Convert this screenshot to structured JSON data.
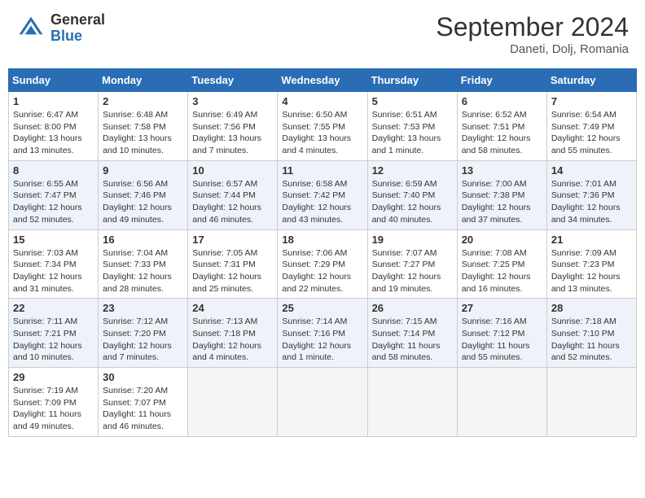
{
  "header": {
    "logo_general": "General",
    "logo_blue": "Blue",
    "title": "September 2024",
    "location": "Daneti, Dolj, Romania"
  },
  "calendar": {
    "days_of_week": [
      "Sunday",
      "Monday",
      "Tuesday",
      "Wednesday",
      "Thursday",
      "Friday",
      "Saturday"
    ],
    "weeks": [
      [
        {
          "day": "1",
          "details": [
            "Sunrise: 6:47 AM",
            "Sunset: 8:00 PM",
            "Daylight: 13 hours",
            "and 13 minutes."
          ]
        },
        {
          "day": "2",
          "details": [
            "Sunrise: 6:48 AM",
            "Sunset: 7:58 PM",
            "Daylight: 13 hours",
            "and 10 minutes."
          ]
        },
        {
          "day": "3",
          "details": [
            "Sunrise: 6:49 AM",
            "Sunset: 7:56 PM",
            "Daylight: 13 hours",
            "and 7 minutes."
          ]
        },
        {
          "day": "4",
          "details": [
            "Sunrise: 6:50 AM",
            "Sunset: 7:55 PM",
            "Daylight: 13 hours",
            "and 4 minutes."
          ]
        },
        {
          "day": "5",
          "details": [
            "Sunrise: 6:51 AM",
            "Sunset: 7:53 PM",
            "Daylight: 13 hours",
            "and 1 minute."
          ]
        },
        {
          "day": "6",
          "details": [
            "Sunrise: 6:52 AM",
            "Sunset: 7:51 PM",
            "Daylight: 12 hours",
            "and 58 minutes."
          ]
        },
        {
          "day": "7",
          "details": [
            "Sunrise: 6:54 AM",
            "Sunset: 7:49 PM",
            "Daylight: 12 hours",
            "and 55 minutes."
          ]
        }
      ],
      [
        {
          "day": "8",
          "details": [
            "Sunrise: 6:55 AM",
            "Sunset: 7:47 PM",
            "Daylight: 12 hours",
            "and 52 minutes."
          ]
        },
        {
          "day": "9",
          "details": [
            "Sunrise: 6:56 AM",
            "Sunset: 7:46 PM",
            "Daylight: 12 hours",
            "and 49 minutes."
          ]
        },
        {
          "day": "10",
          "details": [
            "Sunrise: 6:57 AM",
            "Sunset: 7:44 PM",
            "Daylight: 12 hours",
            "and 46 minutes."
          ]
        },
        {
          "day": "11",
          "details": [
            "Sunrise: 6:58 AM",
            "Sunset: 7:42 PM",
            "Daylight: 12 hours",
            "and 43 minutes."
          ]
        },
        {
          "day": "12",
          "details": [
            "Sunrise: 6:59 AM",
            "Sunset: 7:40 PM",
            "Daylight: 12 hours",
            "and 40 minutes."
          ]
        },
        {
          "day": "13",
          "details": [
            "Sunrise: 7:00 AM",
            "Sunset: 7:38 PM",
            "Daylight: 12 hours",
            "and 37 minutes."
          ]
        },
        {
          "day": "14",
          "details": [
            "Sunrise: 7:01 AM",
            "Sunset: 7:36 PM",
            "Daylight: 12 hours",
            "and 34 minutes."
          ]
        }
      ],
      [
        {
          "day": "15",
          "details": [
            "Sunrise: 7:03 AM",
            "Sunset: 7:34 PM",
            "Daylight: 12 hours",
            "and 31 minutes."
          ]
        },
        {
          "day": "16",
          "details": [
            "Sunrise: 7:04 AM",
            "Sunset: 7:33 PM",
            "Daylight: 12 hours",
            "and 28 minutes."
          ]
        },
        {
          "day": "17",
          "details": [
            "Sunrise: 7:05 AM",
            "Sunset: 7:31 PM",
            "Daylight: 12 hours",
            "and 25 minutes."
          ]
        },
        {
          "day": "18",
          "details": [
            "Sunrise: 7:06 AM",
            "Sunset: 7:29 PM",
            "Daylight: 12 hours",
            "and 22 minutes."
          ]
        },
        {
          "day": "19",
          "details": [
            "Sunrise: 7:07 AM",
            "Sunset: 7:27 PM",
            "Daylight: 12 hours",
            "and 19 minutes."
          ]
        },
        {
          "day": "20",
          "details": [
            "Sunrise: 7:08 AM",
            "Sunset: 7:25 PM",
            "Daylight: 12 hours",
            "and 16 minutes."
          ]
        },
        {
          "day": "21",
          "details": [
            "Sunrise: 7:09 AM",
            "Sunset: 7:23 PM",
            "Daylight: 12 hours",
            "and 13 minutes."
          ]
        }
      ],
      [
        {
          "day": "22",
          "details": [
            "Sunrise: 7:11 AM",
            "Sunset: 7:21 PM",
            "Daylight: 12 hours",
            "and 10 minutes."
          ]
        },
        {
          "day": "23",
          "details": [
            "Sunrise: 7:12 AM",
            "Sunset: 7:20 PM",
            "Daylight: 12 hours",
            "and 7 minutes."
          ]
        },
        {
          "day": "24",
          "details": [
            "Sunrise: 7:13 AM",
            "Sunset: 7:18 PM",
            "Daylight: 12 hours",
            "and 4 minutes."
          ]
        },
        {
          "day": "25",
          "details": [
            "Sunrise: 7:14 AM",
            "Sunset: 7:16 PM",
            "Daylight: 12 hours",
            "and 1 minute."
          ]
        },
        {
          "day": "26",
          "details": [
            "Sunrise: 7:15 AM",
            "Sunset: 7:14 PM",
            "Daylight: 11 hours",
            "and 58 minutes."
          ]
        },
        {
          "day": "27",
          "details": [
            "Sunrise: 7:16 AM",
            "Sunset: 7:12 PM",
            "Daylight: 11 hours",
            "and 55 minutes."
          ]
        },
        {
          "day": "28",
          "details": [
            "Sunrise: 7:18 AM",
            "Sunset: 7:10 PM",
            "Daylight: 11 hours",
            "and 52 minutes."
          ]
        }
      ],
      [
        {
          "day": "29",
          "details": [
            "Sunrise: 7:19 AM",
            "Sunset: 7:09 PM",
            "Daylight: 11 hours",
            "and 49 minutes."
          ]
        },
        {
          "day": "30",
          "details": [
            "Sunrise: 7:20 AM",
            "Sunset: 7:07 PM",
            "Daylight: 11 hours",
            "and 46 minutes."
          ]
        },
        {
          "day": "",
          "details": []
        },
        {
          "day": "",
          "details": []
        },
        {
          "day": "",
          "details": []
        },
        {
          "day": "",
          "details": []
        },
        {
          "day": "",
          "details": []
        }
      ]
    ]
  }
}
